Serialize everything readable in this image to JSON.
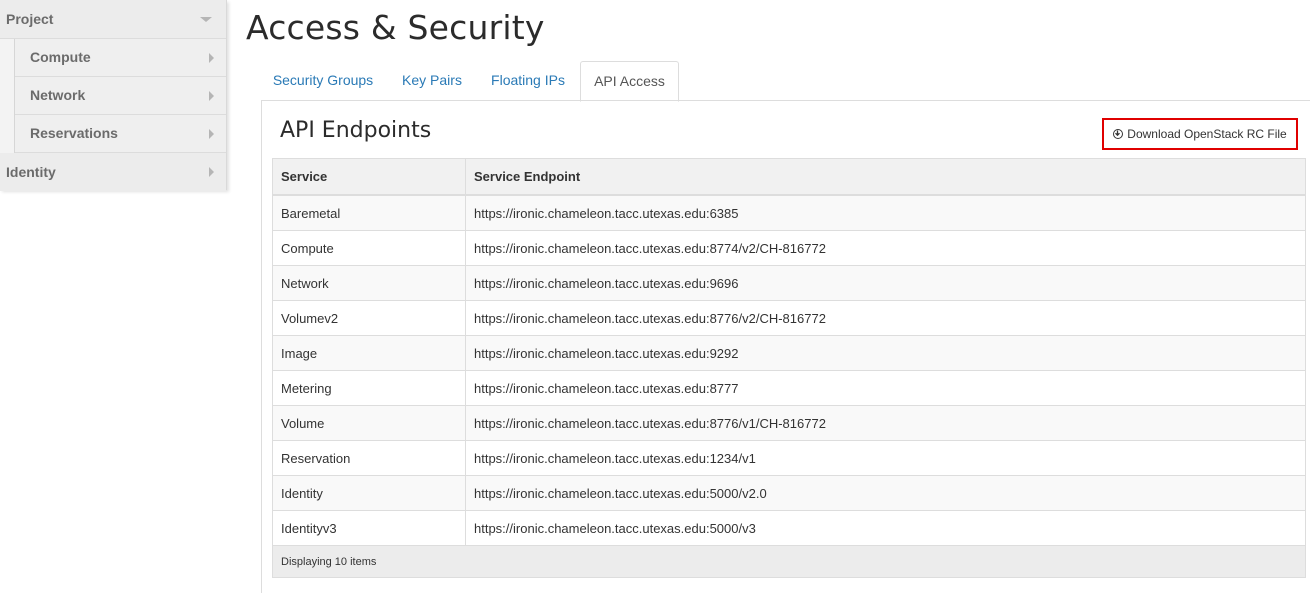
{
  "sidebar": {
    "project_label": "Project",
    "items": [
      {
        "label": "Compute"
      },
      {
        "label": "Network"
      },
      {
        "label": "Reservations"
      }
    ],
    "identity_label": "Identity"
  },
  "page": {
    "title": "Access & Security"
  },
  "tabs": [
    {
      "label": "Security Groups",
      "active": false
    },
    {
      "label": "Key Pairs",
      "active": false
    },
    {
      "label": "Floating IPs",
      "active": false
    },
    {
      "label": "API Access",
      "active": true
    }
  ],
  "panel": {
    "title": "API Endpoints",
    "download_label": "Download OpenStack RC File",
    "download_icon": "download-circle-icon"
  },
  "table": {
    "headers": [
      "Service",
      "Service Endpoint"
    ],
    "rows": [
      [
        "Baremetal",
        "https://ironic.chameleon.tacc.utexas.edu:6385"
      ],
      [
        "Compute",
        "https://ironic.chameleon.tacc.utexas.edu:8774/v2/CH-816772"
      ],
      [
        "Network",
        "https://ironic.chameleon.tacc.utexas.edu:9696"
      ],
      [
        "Volumev2",
        "https://ironic.chameleon.tacc.utexas.edu:8776/v2/CH-816772"
      ],
      [
        "Image",
        "https://ironic.chameleon.tacc.utexas.edu:9292"
      ],
      [
        "Metering",
        "https://ironic.chameleon.tacc.utexas.edu:8777"
      ],
      [
        "Volume",
        "https://ironic.chameleon.tacc.utexas.edu:8776/v1/CH-816772"
      ],
      [
        "Reservation",
        "https://ironic.chameleon.tacc.utexas.edu:1234/v1"
      ],
      [
        "Identity",
        "https://ironic.chameleon.tacc.utexas.edu:5000/v2.0"
      ],
      [
        "Identityv3",
        "https://ironic.chameleon.tacc.utexas.edu:5000/v3"
      ]
    ],
    "footer": "Displaying 10 items"
  },
  "colors": {
    "link": "#2a7ab6",
    "highlight_border": "#e00000"
  }
}
